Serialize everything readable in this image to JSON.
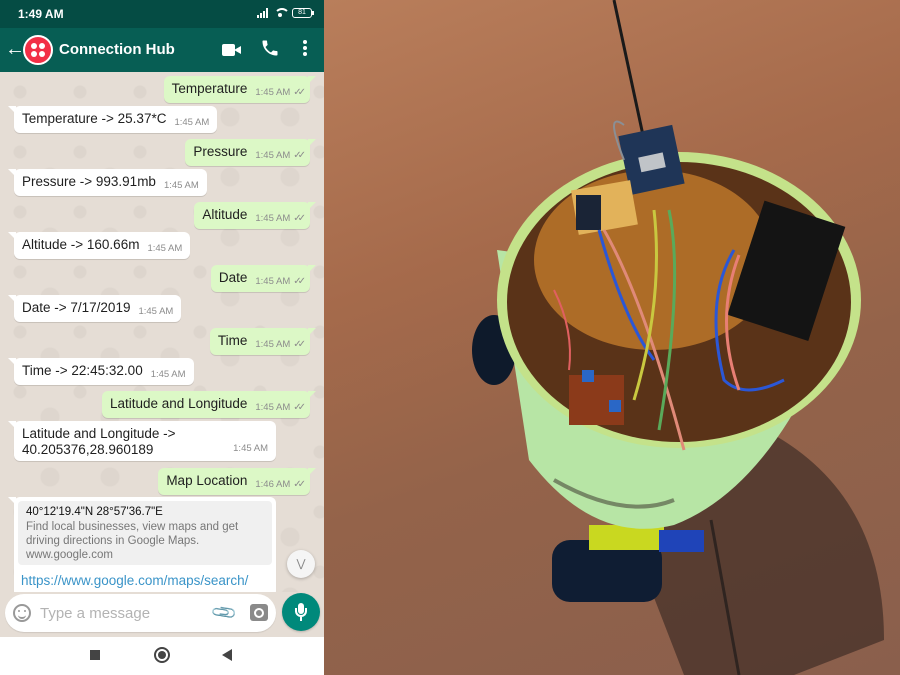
{
  "status_bar": {
    "time": "1:49 AM",
    "battery": "81"
  },
  "header": {
    "title": "Connection Hub",
    "back_icon": "arrow-left-icon",
    "avatar_icon": "twilio-logo-icon",
    "actions": [
      "video-call-icon",
      "phone-icon",
      "more-vert-icon"
    ]
  },
  "messages": [
    {
      "direction": "out",
      "text": "Temperature",
      "time": "1:45 AM",
      "status": "read"
    },
    {
      "direction": "in",
      "text": "Temperature -> 25.37*C",
      "time": "1:45 AM"
    },
    {
      "direction": "out",
      "text": "Pressure",
      "time": "1:45 AM",
      "status": "read"
    },
    {
      "direction": "in",
      "text": "Pressure -> 993.91mb",
      "time": "1:45 AM"
    },
    {
      "direction": "out",
      "text": "Altitude",
      "time": "1:45 AM",
      "status": "read"
    },
    {
      "direction": "in",
      "text": "Altitude -> 160.66m",
      "time": "1:45 AM"
    },
    {
      "direction": "out",
      "text": "Date",
      "time": "1:45 AM",
      "status": "read"
    },
    {
      "direction": "in",
      "text": "Date -> 7/17/2019",
      "time": "1:45 AM"
    },
    {
      "direction": "out",
      "text": "Time",
      "time": "1:45 AM",
      "status": "read"
    },
    {
      "direction": "in",
      "text": "Time -> 22:45:32.00",
      "time": "1:45 AM"
    },
    {
      "direction": "out",
      "text": "Latitude and Longitude",
      "time": "1:45 AM",
      "status": "read"
    },
    {
      "direction": "in",
      "text_line1": "Latitude and Longitude ->",
      "text_line2": "40.205376,28.960189",
      "time": "1:45 AM"
    },
    {
      "direction": "out",
      "text": "Map Location",
      "time": "1:46 AM",
      "status": "read"
    }
  ],
  "link_message": {
    "preview_title": "40°12'19.4\"N 28°57'36.7\"E",
    "preview_desc_line1": "Find local businesses, view maps and get",
    "preview_desc_line2": "driving directions in Google Maps.",
    "preview_domain": "www.google.com",
    "url": "https://www.google.com/maps/search/"
  },
  "ticks": "✓✓",
  "composer": {
    "placeholder": "Type a message"
  },
  "photo": {
    "description": "GPS tracking robot: green cylindrical can on wheels with GPS module, antenna, NodeMCU board, motor driver and jumper wires, on a wooden table"
  },
  "colors": {
    "header": "#075e54",
    "status_bar": "#054c44",
    "outgoing_bubble": "#dcf8c6",
    "incoming_bubble": "#ffffff",
    "chat_bg": "#e5ddd5",
    "mic_button": "#00897b",
    "link": "#3a94c8",
    "avatar": "#f22f46"
  }
}
